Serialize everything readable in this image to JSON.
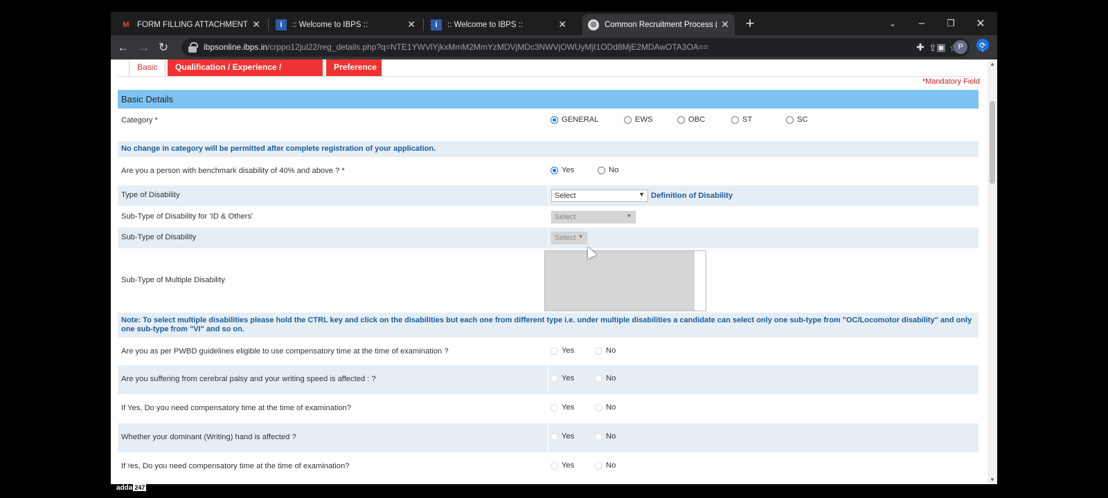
{
  "browser": {
    "tabs": [
      {
        "title": "FORM FILLING ATTACHMENT - p",
        "icon": "gmail-icon"
      },
      {
        "title": ":: Welcome to IBPS ::",
        "icon": "ibps-icon"
      },
      {
        "title": ":: Welcome to IBPS ::",
        "icon": "ibps-icon"
      },
      {
        "title": "Common Recruitment Process (C",
        "icon": "globe-icon"
      }
    ],
    "url_host": "ibpsonline.ibps.in",
    "url_path": "/crppo12jul22/reg_details.php?q=NTE1YWVlYjkxMmM2MmYzMDVjMDc3NWVjOWUyMjI1ODd8MjE2MDAwOTA3OA==",
    "profile_initial": "P"
  },
  "form": {
    "tabs": [
      "Basic",
      "Qualification / Experience / Languages",
      "Preference"
    ],
    "mandatory_note": "*Mandatory Field",
    "section_title": "Basic Details",
    "category": {
      "label": "Category *",
      "options": [
        "GENERAL",
        "EWS",
        "OBC",
        "ST",
        "SC"
      ],
      "selected": "GENERAL"
    },
    "category_note": "No change in category will be permitted after complete registration of your application.",
    "disability_question": "Are you a person with benchmark disability of 40% and above ? *",
    "yes": "Yes",
    "no": "No",
    "type_of_disability": "Type of Disability",
    "select_placeholder": "Select",
    "definition_link": "Definition of Disability",
    "subtype_id": "Sub-Type of Disability for 'ID & Others'",
    "subtype": "Sub-Type of Disability",
    "subtype_multiple": "Sub-Type of Multiple Disability",
    "multi_note": "Note: To select multiple disabilities please hold the CTRL key and click on the disabilities but each one from different type i.e. under multiple disabilities a candidate can select only one sub-type from \"OC/Locomotor disability\" and only one sub-type from \"VI\" and so on.",
    "q_compensatory": "Are you as per PWBD guidelines eligible to use compensatory time at the time of examination ?",
    "q_cerebral": "Are you suffering from cerebral palsy and your writing speed is affected : ?",
    "q_need_comp": "If Yes, Do you need compensatory time at the time of examination?",
    "q_hand": "Whether your dominant (Writing) hand is affected ?",
    "q_need_comp2": "If ʸes, Do you need compensatory time at the time of examination?"
  },
  "watermark": {
    "brand": "adda",
    "num": "247"
  }
}
